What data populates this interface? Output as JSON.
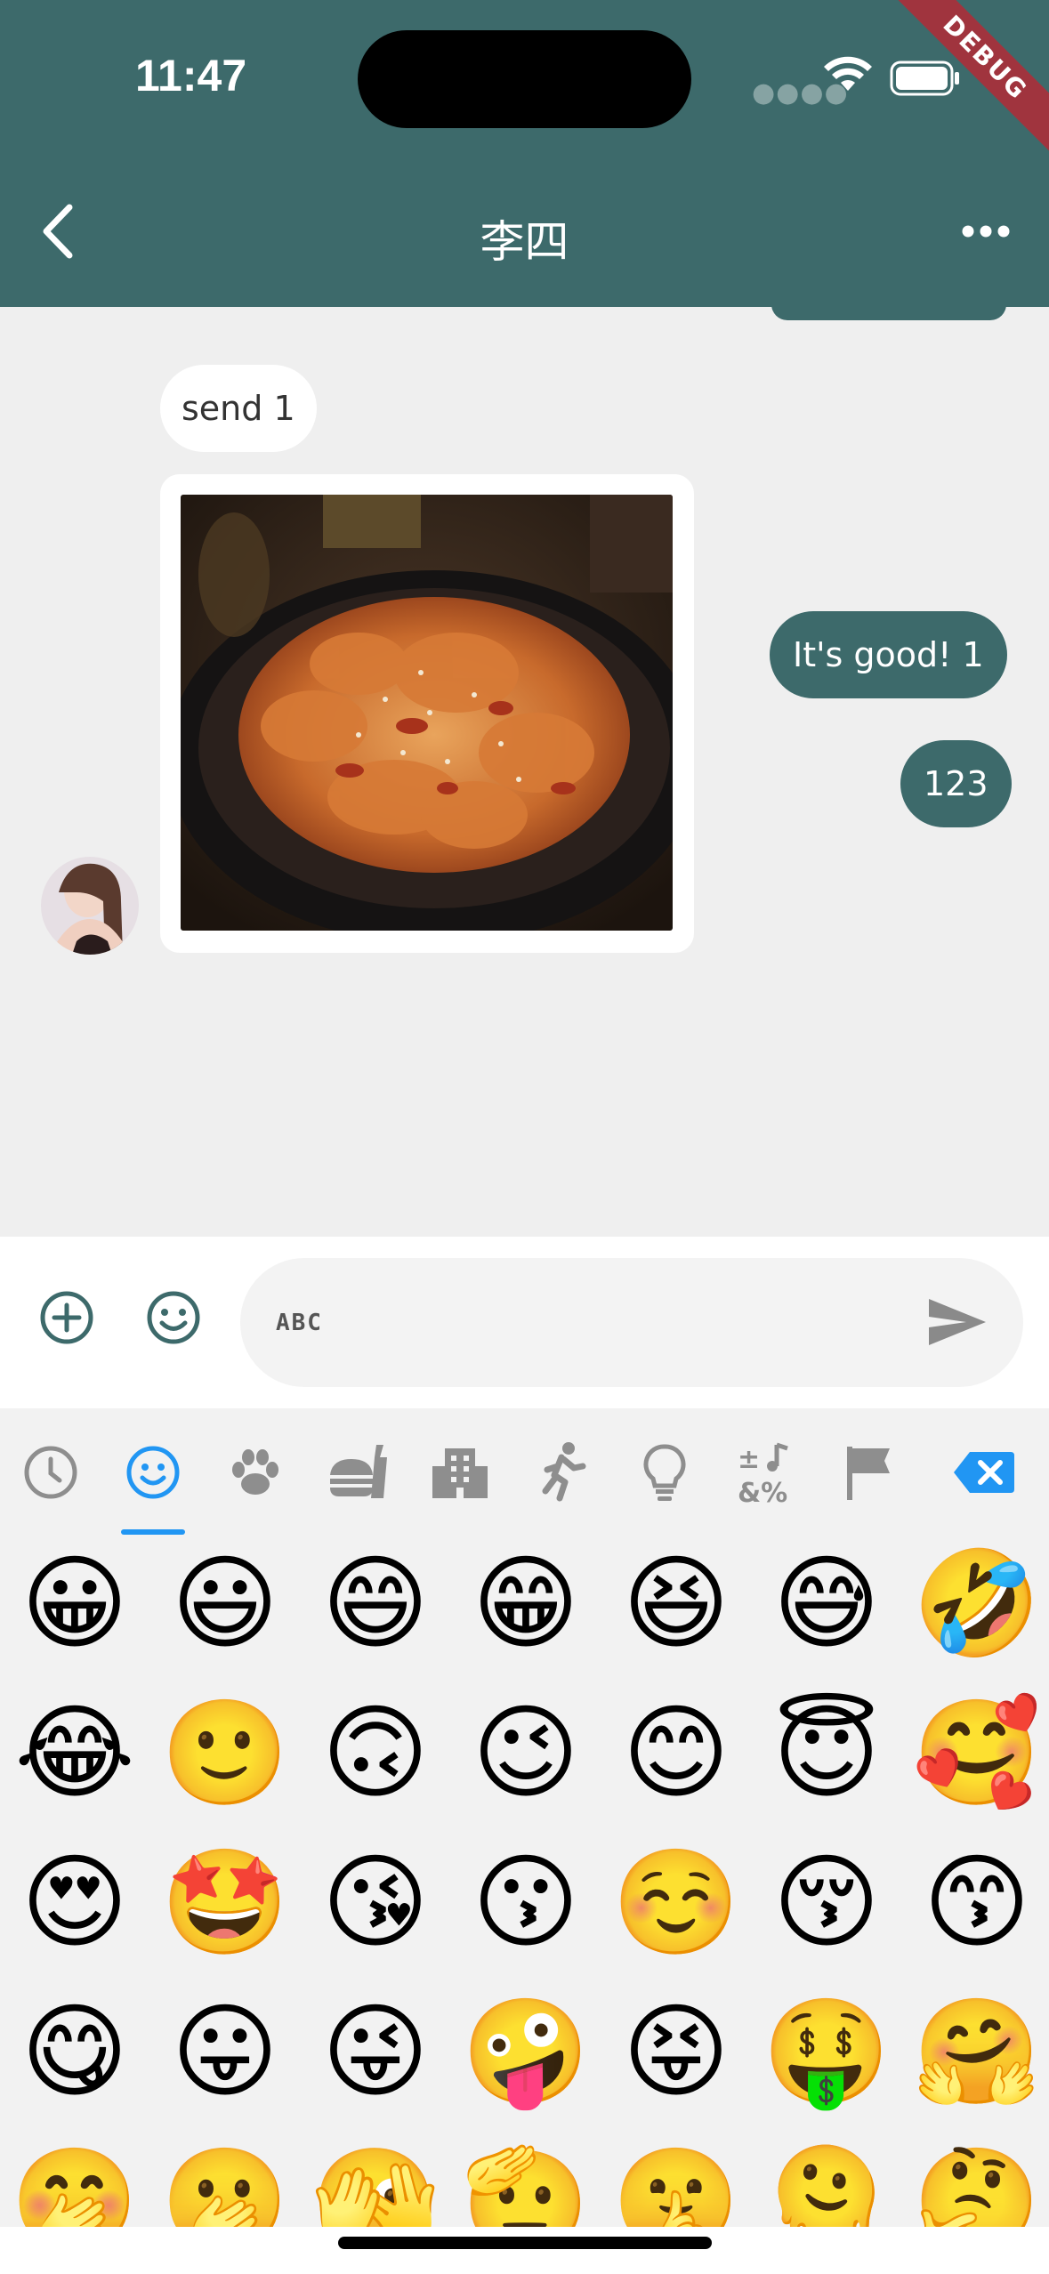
{
  "status_bar": {
    "time": "11:47",
    "debug_banner": "DEBUG"
  },
  "nav": {
    "title": "李四"
  },
  "messages": [
    {
      "side": "in",
      "type": "text",
      "text": "send 1"
    },
    {
      "side": "in",
      "type": "image"
    },
    {
      "side": "out",
      "type": "text",
      "text": "It's good! 1"
    },
    {
      "side": "out",
      "type": "text",
      "text": "123"
    }
  ],
  "input": {
    "value": "ABC"
  },
  "emoji_categories": [
    "recent",
    "smileys",
    "animals",
    "food",
    "travel",
    "activities",
    "objects",
    "symbols",
    "flags"
  ],
  "active_category": "smileys",
  "colors": {
    "primary": "#3d6a6b",
    "accent": "#2196f3",
    "chat_bg": "#efefef"
  },
  "emojis": [
    [
      "😀",
      "😃",
      "😄",
      "😁",
      "😆",
      "😅",
      "🤣"
    ],
    [
      "😂",
      "🙂",
      "🙃",
      "😉",
      "😊",
      "😇",
      "🥰"
    ],
    [
      "😍",
      "🤩",
      "😘",
      "😗",
      "☺️",
      "😚",
      "😙"
    ],
    [
      "😋",
      "😛",
      "😜",
      "🤪",
      "😝",
      "🤑",
      "🤗"
    ],
    [
      "🤭",
      "🫢",
      "🫣",
      "🫡",
      "🤫",
      "🫠",
      "🤔"
    ]
  ]
}
